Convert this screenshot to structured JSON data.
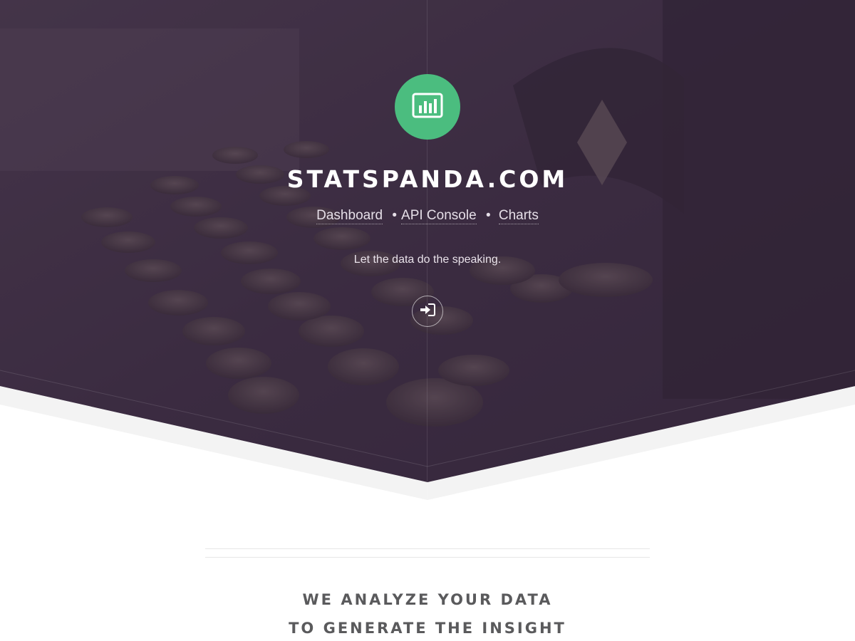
{
  "hero": {
    "site_title": "STATSPANDA.COM",
    "nav": [
      {
        "label": "Dashboard"
      },
      {
        "label": "API Console"
      },
      {
        "label": "Charts"
      }
    ],
    "nav_separator": "•",
    "tagline": "Let the data do the speaking.",
    "logo_icon": "bar-chart-icon",
    "login_icon": "sign-in-icon"
  },
  "intro": {
    "line1": "WE ANALYZE YOUR DATA",
    "line2": "TO GENERATE THE INSIGHT"
  },
  "colors": {
    "accent_green": "#4bbd7f",
    "hero_overlay": "#3f2f45",
    "heading_text": "#5a5a5c"
  }
}
